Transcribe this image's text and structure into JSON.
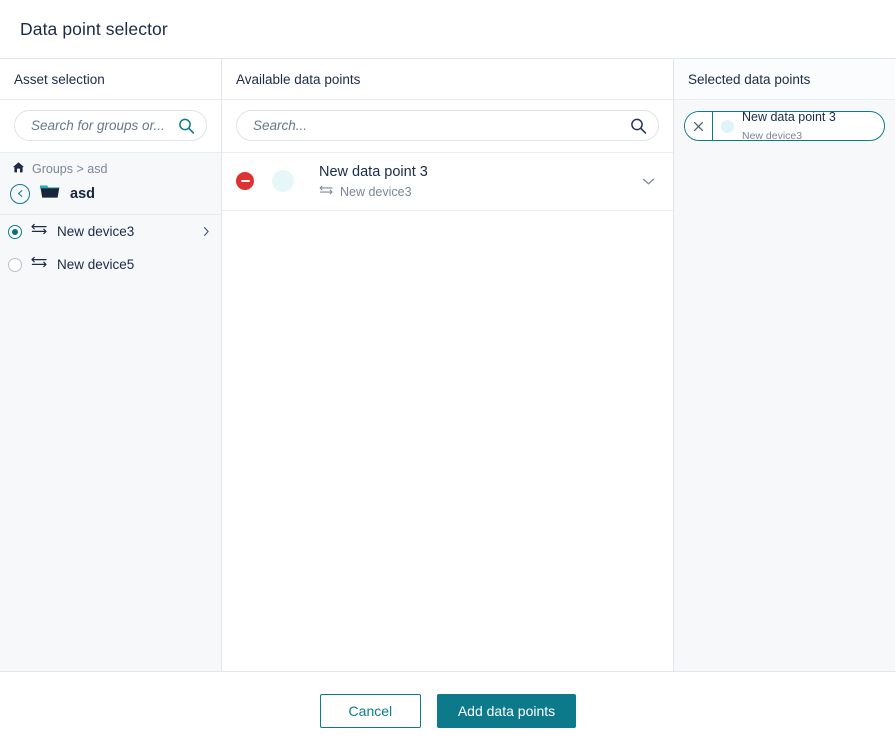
{
  "dialog": {
    "title": "Data point selector"
  },
  "asset_panel": {
    "header": "Asset selection",
    "search": {
      "placeholder": "Search for groups or...",
      "value": ""
    },
    "breadcrumb": {
      "home_icon": "home-icon",
      "path": "Groups > asd"
    },
    "current_folder": {
      "name": "asd",
      "back_icon": "chevron-left-icon",
      "folder_icon": "folder-icon"
    },
    "assets": [
      {
        "label": "New device3",
        "icon": "device-exchange-icon",
        "selected": true,
        "has_chevron": true
      },
      {
        "label": "New device5",
        "icon": "device-exchange-icon",
        "selected": false,
        "has_chevron": false
      }
    ]
  },
  "available_panel": {
    "header": "Available data points",
    "search": {
      "placeholder": "Search...",
      "value": ""
    },
    "rows": [
      {
        "title": "New data point 3",
        "subtitle": "New device3",
        "sub_icon": "device-exchange-icon",
        "remove_icon": "minus-circle-icon",
        "expand_icon": "chevron-down-icon",
        "swatch_color": "#E6F7FA"
      }
    ]
  },
  "selected_panel": {
    "header": "Selected data points",
    "chips": [
      {
        "title": "New data point 3",
        "subtitle": "New device3",
        "close_icon": "close-icon",
        "swatch_color": "#DEF4F9"
      }
    ]
  },
  "footer": {
    "cancel_label": "Cancel",
    "submit_label": "Add data points"
  },
  "colors": {
    "accent_teal": "#0D7A8C",
    "danger_red": "#E03131",
    "text_navy": "#1B2A47",
    "muted_gray": "#7A8799",
    "panel_bg": "#F7F8FA"
  }
}
